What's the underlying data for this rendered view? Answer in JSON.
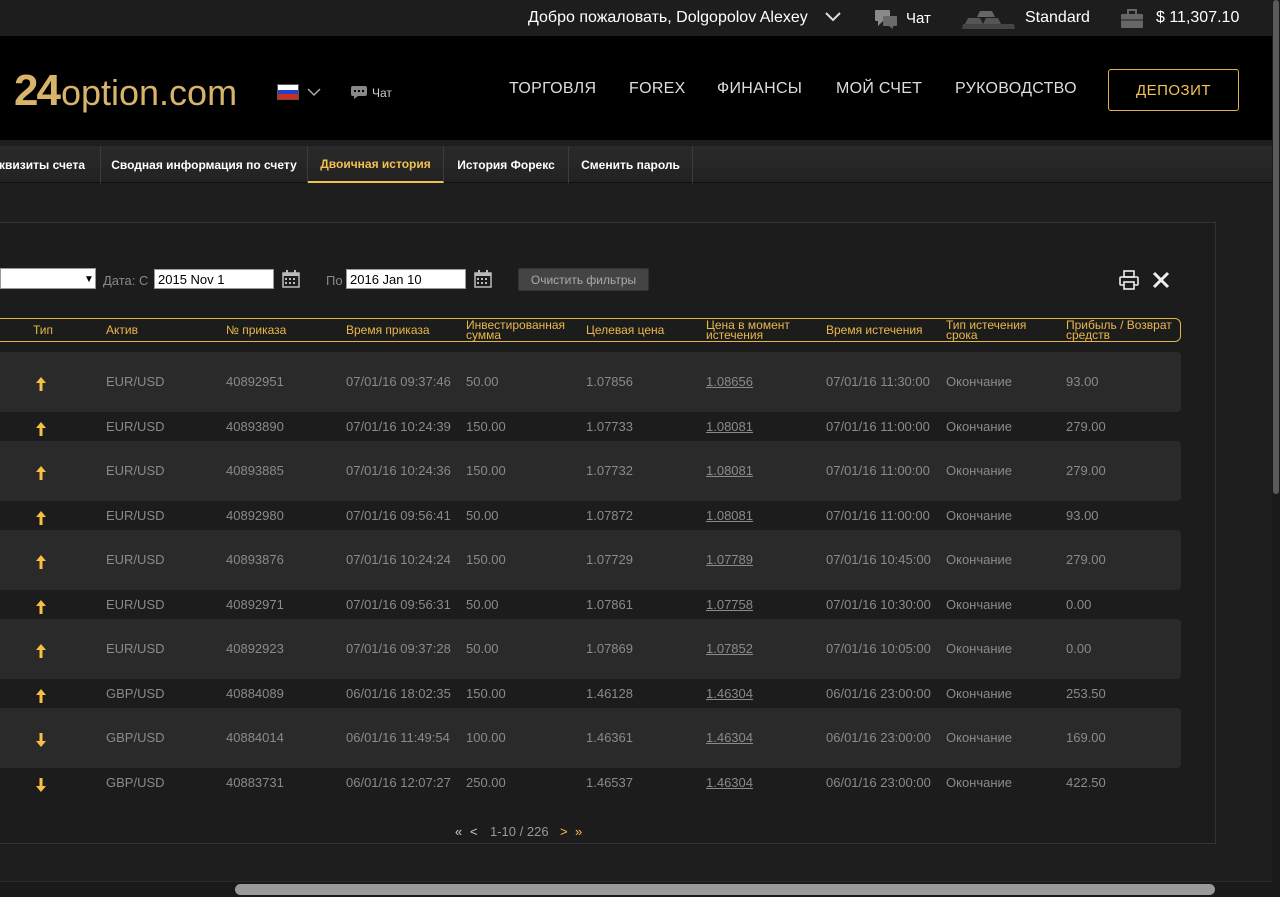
{
  "topbar": {
    "welcome": "Добро пожаловать, Dolgopolov Alexey",
    "chat": "Чат",
    "level": "Standard",
    "balance": "$ 11,307.10"
  },
  "header": {
    "logo_num": "24",
    "logo_text": "option.com",
    "chat": "Чат",
    "nav": [
      "ТОРГОВЛЯ",
      "FOREX",
      "ФИНАНСЫ",
      "МОЙ СЧЕТ",
      "РУКОВОДСТВО"
    ],
    "deposit": "ДЕПОЗИТ"
  },
  "tabs": [
    "еквизиты счета",
    "Сводная информация по счету",
    "Двоичная история",
    "История Форекс",
    "Сменить пароль"
  ],
  "filters": {
    "date_label": "Дата: С",
    "date_from": "2015 Nov 1",
    "to_label": "По",
    "date_to": "2016 Jan 10",
    "clear_button": "Очистить фильтры"
  },
  "table": {
    "headers": [
      "Тип",
      "Актив",
      "№ приказа",
      "Время приказа",
      "Инвестированная сумма",
      "Целевая цена",
      "Цена в момент истечения",
      "Время истечения",
      "Тип истечения срока",
      "Прибыль / Возврат средств"
    ],
    "rows": [
      {
        "dir": "up",
        "asset": "EUR/USD",
        "order": "40892951",
        "time": "07/01/16 09:37:46",
        "amount": "50.00",
        "target": "1.07856",
        "expiry_price": "1.08656",
        "expiry_time": "07/01/16 11:30:00",
        "expiry_type": "Окончание",
        "profit": "93.00"
      },
      {
        "dir": "up",
        "asset": "EUR/USD",
        "order": "40893890",
        "time": "07/01/16 10:24:39",
        "amount": "150.00",
        "target": "1.07733",
        "expiry_price": "1.08081",
        "expiry_time": "07/01/16 11:00:00",
        "expiry_type": "Окончание",
        "profit": "279.00"
      },
      {
        "dir": "up",
        "asset": "EUR/USD",
        "order": "40893885",
        "time": "07/01/16 10:24:36",
        "amount": "150.00",
        "target": "1.07732",
        "expiry_price": "1.08081",
        "expiry_time": "07/01/16 11:00:00",
        "expiry_type": "Окончание",
        "profit": "279.00"
      },
      {
        "dir": "up",
        "asset": "EUR/USD",
        "order": "40892980",
        "time": "07/01/16 09:56:41",
        "amount": "50.00",
        "target": "1.07872",
        "expiry_price": "1.08081",
        "expiry_time": "07/01/16 11:00:00",
        "expiry_type": "Окончание",
        "profit": "93.00"
      },
      {
        "dir": "up",
        "asset": "EUR/USD",
        "order": "40893876",
        "time": "07/01/16 10:24:24",
        "amount": "150.00",
        "target": "1.07729",
        "expiry_price": "1.07789",
        "expiry_time": "07/01/16 10:45:00",
        "expiry_type": "Окончание",
        "profit": "279.00"
      },
      {
        "dir": "up",
        "asset": "EUR/USD",
        "order": "40892971",
        "time": "07/01/16 09:56:31",
        "amount": "50.00",
        "target": "1.07861",
        "expiry_price": "1.07758",
        "expiry_time": "07/01/16 10:30:00",
        "expiry_type": "Окончание",
        "profit": "0.00"
      },
      {
        "dir": "up",
        "asset": "EUR/USD",
        "order": "40892923",
        "time": "07/01/16 09:37:28",
        "amount": "50.00",
        "target": "1.07869",
        "expiry_price": "1.07852",
        "expiry_time": "07/01/16 10:05:00",
        "expiry_type": "Окончание",
        "profit": "0.00"
      },
      {
        "dir": "up",
        "asset": "GBP/USD",
        "order": "40884089",
        "time": "06/01/16 18:02:35",
        "amount": "150.00",
        "target": "1.46128",
        "expiry_price": "1.46304",
        "expiry_time": "06/01/16 23:00:00",
        "expiry_type": "Окончание",
        "profit": "253.50"
      },
      {
        "dir": "down",
        "asset": "GBP/USD",
        "order": "40884014",
        "time": "06/01/16 11:49:54",
        "amount": "100.00",
        "target": "1.46361",
        "expiry_price": "1.46304",
        "expiry_time": "06/01/16 23:00:00",
        "expiry_type": "Окончание",
        "profit": "169.00"
      },
      {
        "dir": "down",
        "asset": "GBP/USD",
        "order": "40883731",
        "time": "06/01/16 12:07:27",
        "amount": "250.00",
        "target": "1.46537",
        "expiry_price": "1.46304",
        "expiry_time": "06/01/16 23:00:00",
        "expiry_type": "Окончание",
        "profit": "422.50"
      }
    ]
  },
  "pagination": {
    "first": "«",
    "prev": "<",
    "range": "1-10 / 226",
    "next": ">",
    "last": "»"
  },
  "colors": {
    "accent": "#f2c14e",
    "up_arrow": "#f5c043",
    "down_arrow": "#f5c043"
  }
}
